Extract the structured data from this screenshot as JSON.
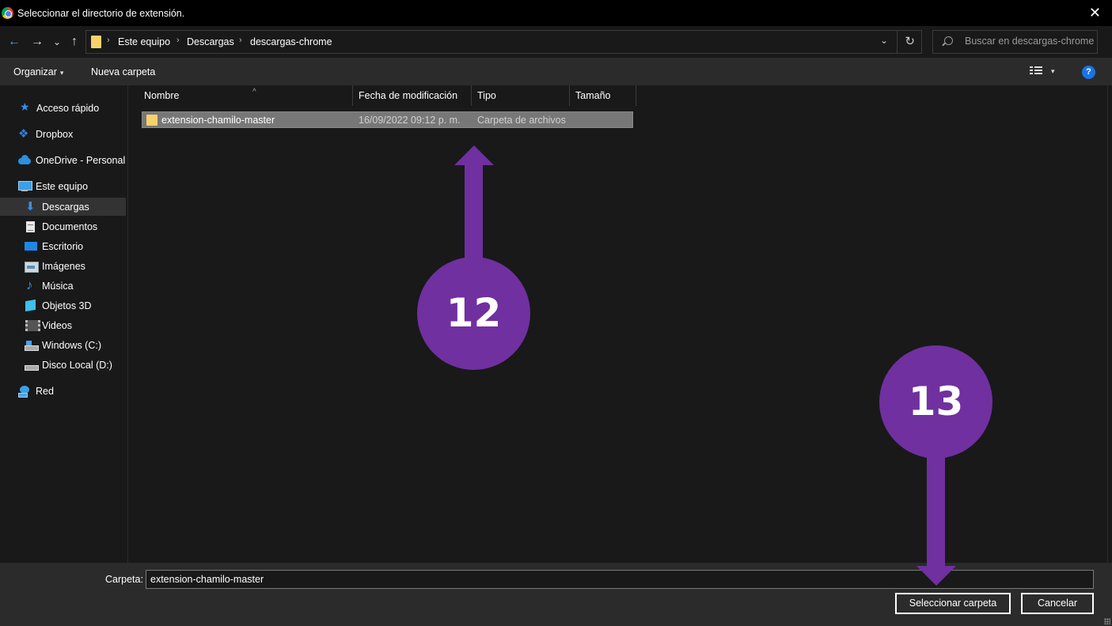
{
  "window": {
    "title": "Seleccionar el directorio de extensión.",
    "close_glyph": "✕"
  },
  "nav": {
    "back_glyph": "←",
    "forward_glyph": "→",
    "recent_glyph": "⌄",
    "up_glyph": "↑",
    "breadcrumb": [
      "Este equipo",
      "Descargas",
      "descargas-chrome"
    ],
    "breadcrumb_sep": "›",
    "dropdown_glyph": "⌄",
    "refresh_glyph": "↻",
    "search_placeholder": "Buscar en descargas-chrome"
  },
  "command_bar": {
    "organize_label": "Organizar",
    "caret": "▾",
    "new_folder_label": "Nueva carpeta",
    "view_caret": "▾",
    "help_label": "?"
  },
  "sidebar": {
    "items": [
      {
        "label": "Acceso rápido",
        "icon": "quick-access-star-icon"
      },
      {
        "label": "Dropbox",
        "icon": "dropbox-icon"
      },
      {
        "label": "OneDrive - Personal",
        "icon": "onedrive-cloud-icon"
      },
      {
        "label": "Este equipo",
        "icon": "this-pc-icon"
      },
      {
        "label": "Descargas",
        "icon": "downloads-icon",
        "selected": true
      },
      {
        "label": "Documentos",
        "icon": "documents-icon"
      },
      {
        "label": "Escritorio",
        "icon": "desktop-icon"
      },
      {
        "label": "Imágenes",
        "icon": "pictures-icon"
      },
      {
        "label": "Música",
        "icon": "music-icon"
      },
      {
        "label": "Objetos 3D",
        "icon": "3d-objects-icon"
      },
      {
        "label": "Videos",
        "icon": "videos-icon"
      },
      {
        "label": "Windows (C:)",
        "icon": "drive-c-icon"
      },
      {
        "label": "Disco Local (D:)",
        "icon": "drive-d-icon"
      },
      {
        "label": "Red",
        "icon": "network-icon"
      }
    ]
  },
  "file_list": {
    "sort_glyph": "^",
    "columns": [
      "Nombre",
      "Fecha de modificación",
      "Tipo",
      "Tamaño"
    ],
    "rows": [
      {
        "name": "extension-chamilo-master",
        "modified": "16/09/2022 09:12 p. m.",
        "type": "Carpeta de archivos",
        "size": ""
      }
    ]
  },
  "footer": {
    "folder_label": "Carpeta:",
    "folder_value": "extension-chamilo-master",
    "select_button": "Seleccionar carpeta",
    "cancel_button": "Cancelar"
  },
  "annotations": {
    "step_12": "12",
    "step_13": "13"
  },
  "colors": {
    "annotation": "#7030a0",
    "folder": "#f7d26c",
    "background": "#191919"
  }
}
